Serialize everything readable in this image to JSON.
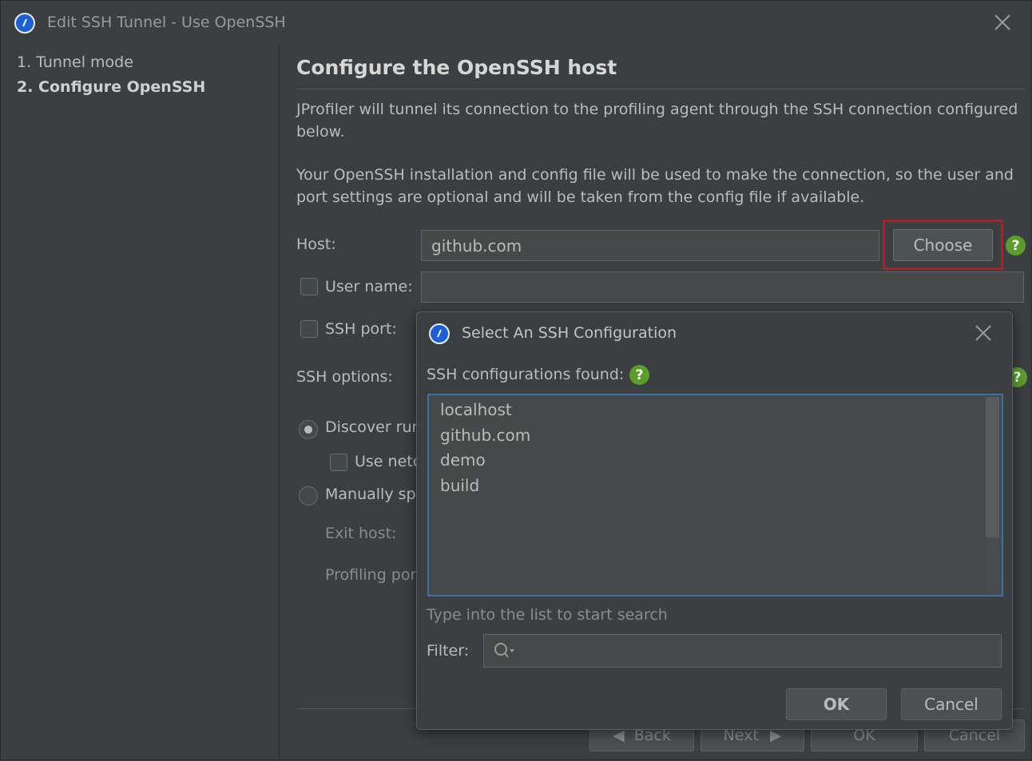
{
  "window": {
    "title": "Edit SSH Tunnel - Use OpenSSH",
    "app_icon": "jprofiler-icon",
    "close_icon": "close-icon"
  },
  "sidebar": {
    "steps": [
      {
        "label": "1. Tunnel mode",
        "active": false
      },
      {
        "label": "2. Configure OpenSSH",
        "active": true
      }
    ]
  },
  "main": {
    "heading": "Configure the OpenSSH host",
    "para1": "JProfiler will tunnel its connection to the profiling agent through the SSH connection configured below.",
    "para2": "Your OpenSSH installation and config file will be used to make the connection, so the user and port settings are optional and will be taken from the config file if available.",
    "host_label": "Host:",
    "host_value": "github.com",
    "choose_label": "Choose",
    "username_label": "User name:",
    "username_value": "",
    "sshport_label": "SSH port:",
    "sshoptions_label": "SSH options:",
    "discover_label": "Discover run",
    "usenetc_label": "Use netc",
    "manually_label": "Manually sp",
    "exithost_label": "Exit host:",
    "profilingport_label": "Profiling por",
    "help_symbol": "?"
  },
  "footer": {
    "back_label": "Back",
    "next_label": "Next",
    "ok_label": "OK",
    "cancel_label": "Cancel"
  },
  "dialog": {
    "title": "Select An SSH Configuration",
    "found_label": "SSH configurations found:",
    "items": [
      "localhost",
      "github.com",
      "demo",
      "build"
    ],
    "hint": "Type into the list to start search",
    "filter_label": "Filter:",
    "ok_label": "OK",
    "cancel_label": "Cancel"
  },
  "colors": {
    "background": "#3c3f41",
    "field": "#45494a",
    "help_green": "#5a9e2a",
    "highlight_red": "#c4161c",
    "list_border": "#3d6fa8"
  }
}
